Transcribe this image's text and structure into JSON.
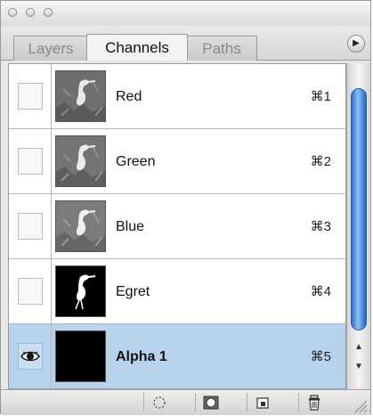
{
  "window": {
    "buttons": [
      "close-icon",
      "minimize-icon",
      "zoom-icon"
    ]
  },
  "tabs": [
    {
      "label": "Layers",
      "active": false
    },
    {
      "label": "Channels",
      "active": true
    },
    {
      "label": "Paths",
      "active": false
    }
  ],
  "panel_menu_icon": "play-right-icon",
  "channels": [
    {
      "name": "Red",
      "shortcut": "⌘1",
      "visible": false,
      "thumbnail": "egret-grayscale"
    },
    {
      "name": "Green",
      "shortcut": "⌘2",
      "visible": false,
      "thumbnail": "egret-grayscale"
    },
    {
      "name": "Blue",
      "shortcut": "⌘3",
      "visible": false,
      "thumbnail": "egret-grayscale"
    },
    {
      "name": "Egret",
      "shortcut": "⌘4",
      "visible": false,
      "thumbnail": "egret-mask"
    },
    {
      "name": "Alpha 1",
      "shortcut": "⌘5",
      "visible": true,
      "selected": true,
      "thumbnail": "black"
    }
  ],
  "footer_buttons": [
    "load-selection-icon",
    "save-selection-icon",
    "new-channel-icon",
    "trash-icon"
  ],
  "colors": {
    "selected_row": "#b6d2ec",
    "scroll_thumb": "#3b7fd4"
  }
}
